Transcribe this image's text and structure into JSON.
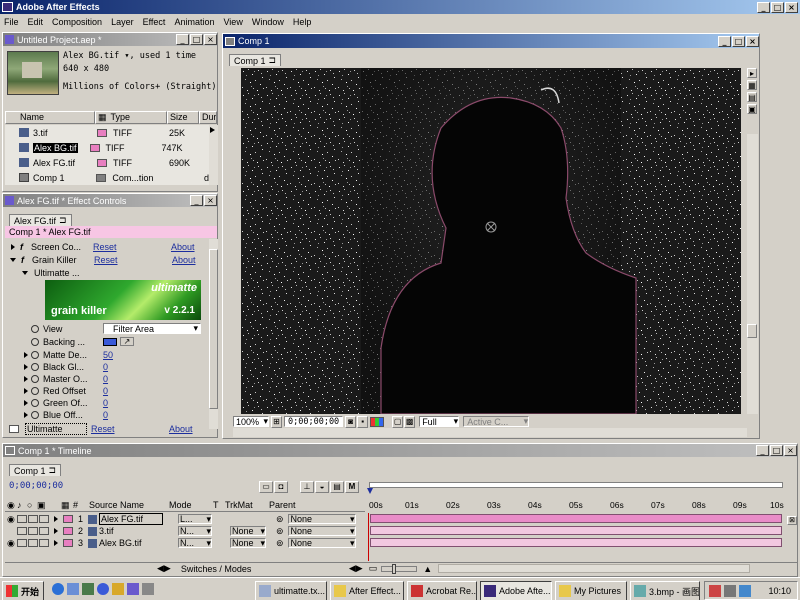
{
  "app": {
    "title": "Adobe After Effects"
  },
  "menu": [
    "File",
    "Edit",
    "Composition",
    "Layer",
    "Effect",
    "Animation",
    "View",
    "Window",
    "Help"
  ],
  "project_panel": {
    "title": "Untitled Project.aep *",
    "info": {
      "name": "Alex BG.tif ▾, used 1 time",
      "size": "640 x 480",
      "colors": "Millions of Colors+ (Straight)"
    },
    "columns": [
      "Name",
      "Type",
      "Size",
      "Dur"
    ],
    "items": [
      {
        "name": "3.tif",
        "type": "TIFF",
        "size": "25K",
        "color": "#e87fc0"
      },
      {
        "name": "Alex BG.tif",
        "type": "TIFF",
        "size": "747K",
        "color": "#e87fc0"
      },
      {
        "name": "Alex FG.tif",
        "type": "TIFF",
        "size": "690K",
        "color": "#e87fc0"
      },
      {
        "name": "Comp 1",
        "type": "Com...tion",
        "size": "",
        "color": "#808080"
      }
    ],
    "dur_letter": "d"
  },
  "effect_panel": {
    "title": "Alex FG.tif * Effect Controls",
    "tab": "Alex FG.tif",
    "path": "Comp 1 * Alex FG.tif",
    "reset": "Reset",
    "about": "About",
    "effects": [
      "Screen Co...",
      "Grain Killer",
      "Ultimatte ..."
    ],
    "logo": {
      "brand": "ultimatte",
      "product": "grain killer",
      "version": "v 2.2.1"
    },
    "params": [
      {
        "label": "View",
        "value": "Filter Area"
      },
      {
        "label": "Backing ..."
      },
      {
        "label": "Matte De...",
        "value": "50"
      },
      {
        "label": "Black Gl...",
        "value": "0"
      },
      {
        "label": "Master O...",
        "value": "0"
      },
      {
        "label": "Red Offset",
        "value": "0"
      },
      {
        "label": "Green Of...",
        "value": "0"
      },
      {
        "label": "Blue Off...",
        "value": "0"
      }
    ],
    "bottom_effect": "Ultimatte"
  },
  "comp_window": {
    "title": "Comp 1",
    "tab": "Comp 1",
    "zoom": "100%",
    "time": "0;00;00;00",
    "resolution": "Full",
    "camera": "Active C..."
  },
  "timeline": {
    "title": "Comp 1 * Timeline",
    "tab": "Comp 1",
    "time": "0;00;00;00",
    "columns": {
      "num": "#",
      "source": "Source Name",
      "mode": "Mode",
      "t": "T",
      "trkmat": "TrkMat",
      "parent": "Parent"
    },
    "layers": [
      {
        "num": "1",
        "name": "Alex FG.tif",
        "mode": "L...",
        "trkmat": "",
        "parent": "None"
      },
      {
        "num": "2",
        "name": "3.tif",
        "mode": "N...",
        "trkmat": "None",
        "parent": "None"
      },
      {
        "num": "3",
        "name": "Alex BG.tif",
        "mode": "N...",
        "trkmat": "None",
        "parent": "None"
      }
    ],
    "ruler": [
      "00s",
      "01s",
      "02s",
      "03s",
      "04s",
      "05s",
      "06s",
      "07s",
      "08s",
      "09s",
      "10s"
    ],
    "switches_label": "Switches / Modes"
  },
  "taskbar": {
    "start": "开始",
    "buttons": [
      "ultimatte.tx...",
      "After Effect...",
      "Acrobat Re...",
      "Adobe Afte...",
      "My Pictures",
      "3.bmp - 画图"
    ],
    "clock": "10:10"
  }
}
